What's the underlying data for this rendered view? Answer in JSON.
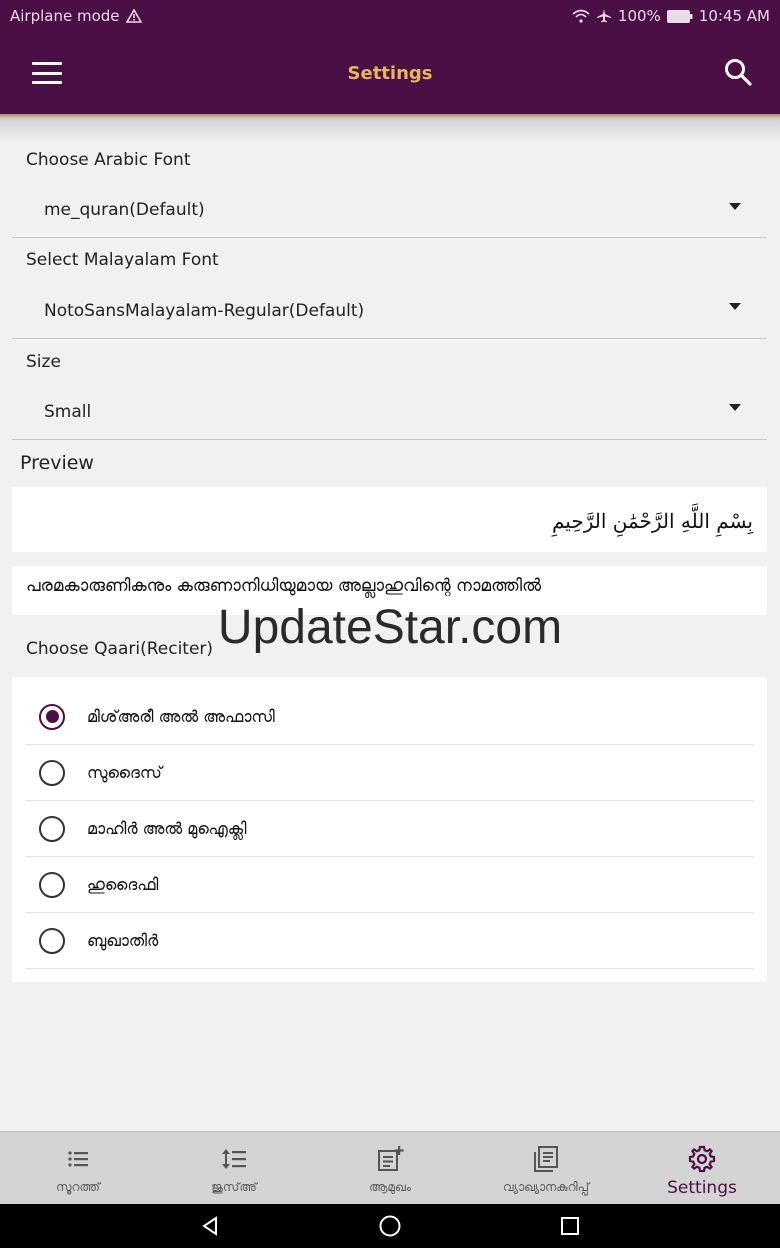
{
  "status_bar": {
    "left_text": "Airplane mode",
    "battery": "100%",
    "time": "10:45 AM"
  },
  "app_bar": {
    "title": "Settings"
  },
  "settings": {
    "arabic_font": {
      "label": "Choose Arabic Font",
      "value": "me_quran(Default)"
    },
    "malayalam_font": {
      "label": "Select Malayalam Font",
      "value": "NotoSansMalayalam-Regular(Default)"
    },
    "size": {
      "label": "Size",
      "value": "Small"
    }
  },
  "preview": {
    "label": "Preview",
    "arabic": "بِسْمِ اللَّهِ الرَّحْمَٰنِ الرَّحِيمِ",
    "malayalam": "പരമകാരുണികനും കരുണാനിധിയുമായ അല്ലാഹുവിന്റെ നാമത്തിൽ"
  },
  "qaari": {
    "label": "Choose Qaari(Reciter)",
    "options": [
      {
        "label": "മിശ്അരീ അൽ അഫാസി",
        "selected": true
      },
      {
        "label": "സുദൈസ്",
        "selected": false
      },
      {
        "label": "മാഹിർ അൽ മുഐക്ലി",
        "selected": false
      },
      {
        "label": "ഹുദൈഫി",
        "selected": false
      },
      {
        "label": "ബുഖാതിർ",
        "selected": false
      }
    ]
  },
  "watermark": "UpdateStar.com",
  "bottom_nav": {
    "items": [
      {
        "label": "സൂറത്ത്",
        "icon": "list-icon"
      },
      {
        "label": "ജുസ്അ്",
        "icon": "line-spacing-icon"
      },
      {
        "label": "ആമുഖം",
        "icon": "note-add-icon"
      },
      {
        "label": "വ്യാഖ്യാനകുറിപ്പ്",
        "icon": "library-books-icon"
      },
      {
        "label": "Settings",
        "icon": "gear-icon",
        "active": true
      }
    ]
  },
  "colors": {
    "primary": "#4a0f45",
    "accent": "#e8b45c",
    "background": "#f1f1f1"
  }
}
